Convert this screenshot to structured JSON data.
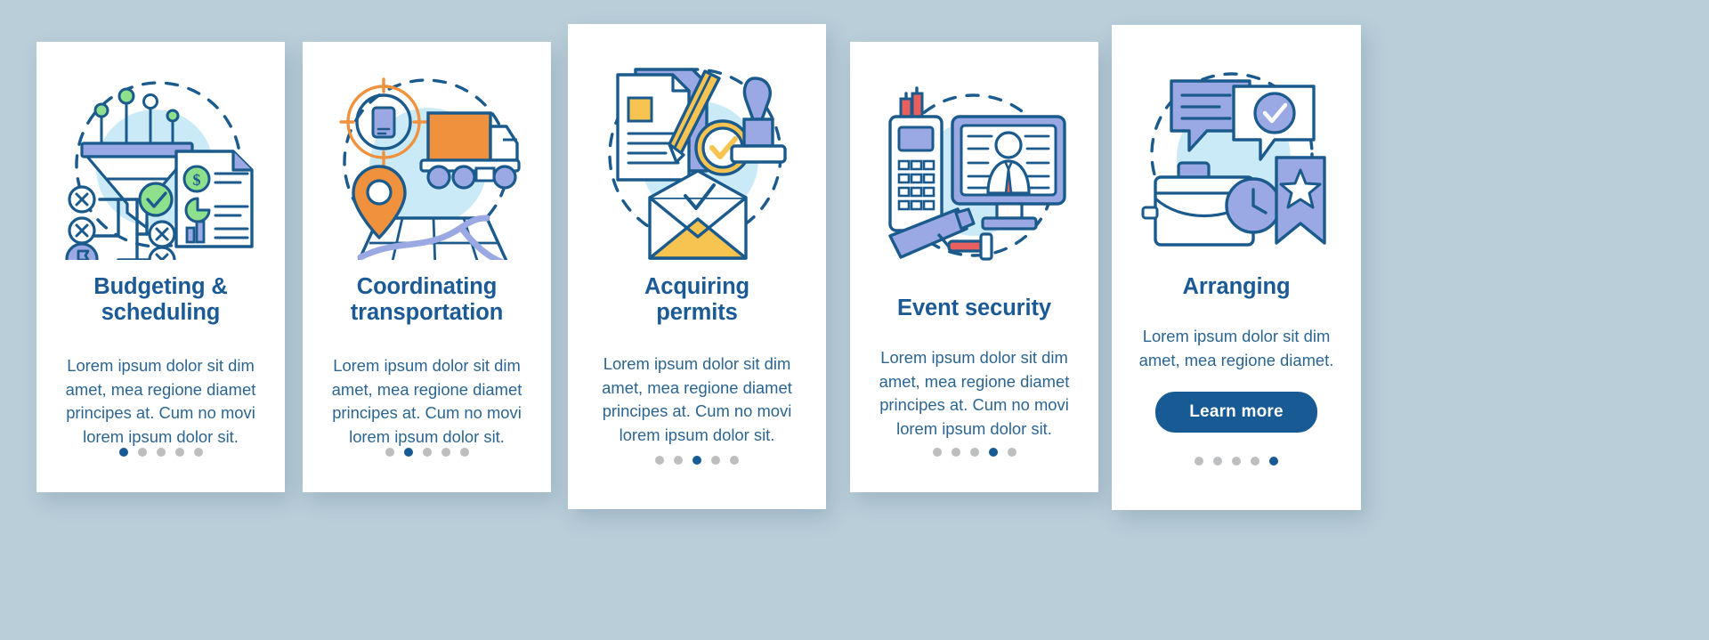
{
  "page": {
    "background_color": "#b9ced9",
    "title_color": "#1b5a94",
    "body_color": "#2b6590",
    "dot_active_color": "#175a94",
    "dot_inactive_color": "#bcbec0"
  },
  "cards": [
    {
      "title": "Budgeting &\nscheduling",
      "body": "Lorem ipsum dolor sit dim\namet, mea regione diamet\nprincipes at. Cum no movi\nlorem ipsum dolor sit.",
      "illustration": "funnel-chart-report-icon",
      "dots": {
        "count": 5,
        "active": 0
      },
      "button": null
    },
    {
      "title": "Coordinating\ntransportation",
      "body": "Lorem ipsum dolor sit dim\namet, mea regione diamet\nprincipes at. Cum no movi\nlorem ipsum dolor sit.",
      "illustration": "truck-map-pin-icon",
      "dots": {
        "count": 5,
        "active": 1
      },
      "button": null
    },
    {
      "title": "Acquiring\npermits",
      "body": "Lorem ipsum dolor sit dim\namet, mea regione diamet\nprincipes at. Cum no movi\nlorem ipsum dolor sit.",
      "illustration": "document-stamp-envelope-icon",
      "dots": {
        "count": 5,
        "active": 2
      },
      "button": null
    },
    {
      "title": "Event security",
      "body": "Lorem ipsum dolor sit dim\namet, mea regione diamet\nprincipes at. Cum no movi\nlorem ipsum dolor sit.",
      "illustration": "radio-cctv-monitor-icon",
      "dots": {
        "count": 5,
        "active": 3
      },
      "button": null
    },
    {
      "title": "Arranging",
      "body": "Lorem ipsum dolor sit dim\namet, mea regione diamet.",
      "illustration": "briefcase-chat-bookmark-icon",
      "dots": {
        "count": 5,
        "active": 4
      },
      "button": {
        "label": "Learn more"
      }
    }
  ]
}
